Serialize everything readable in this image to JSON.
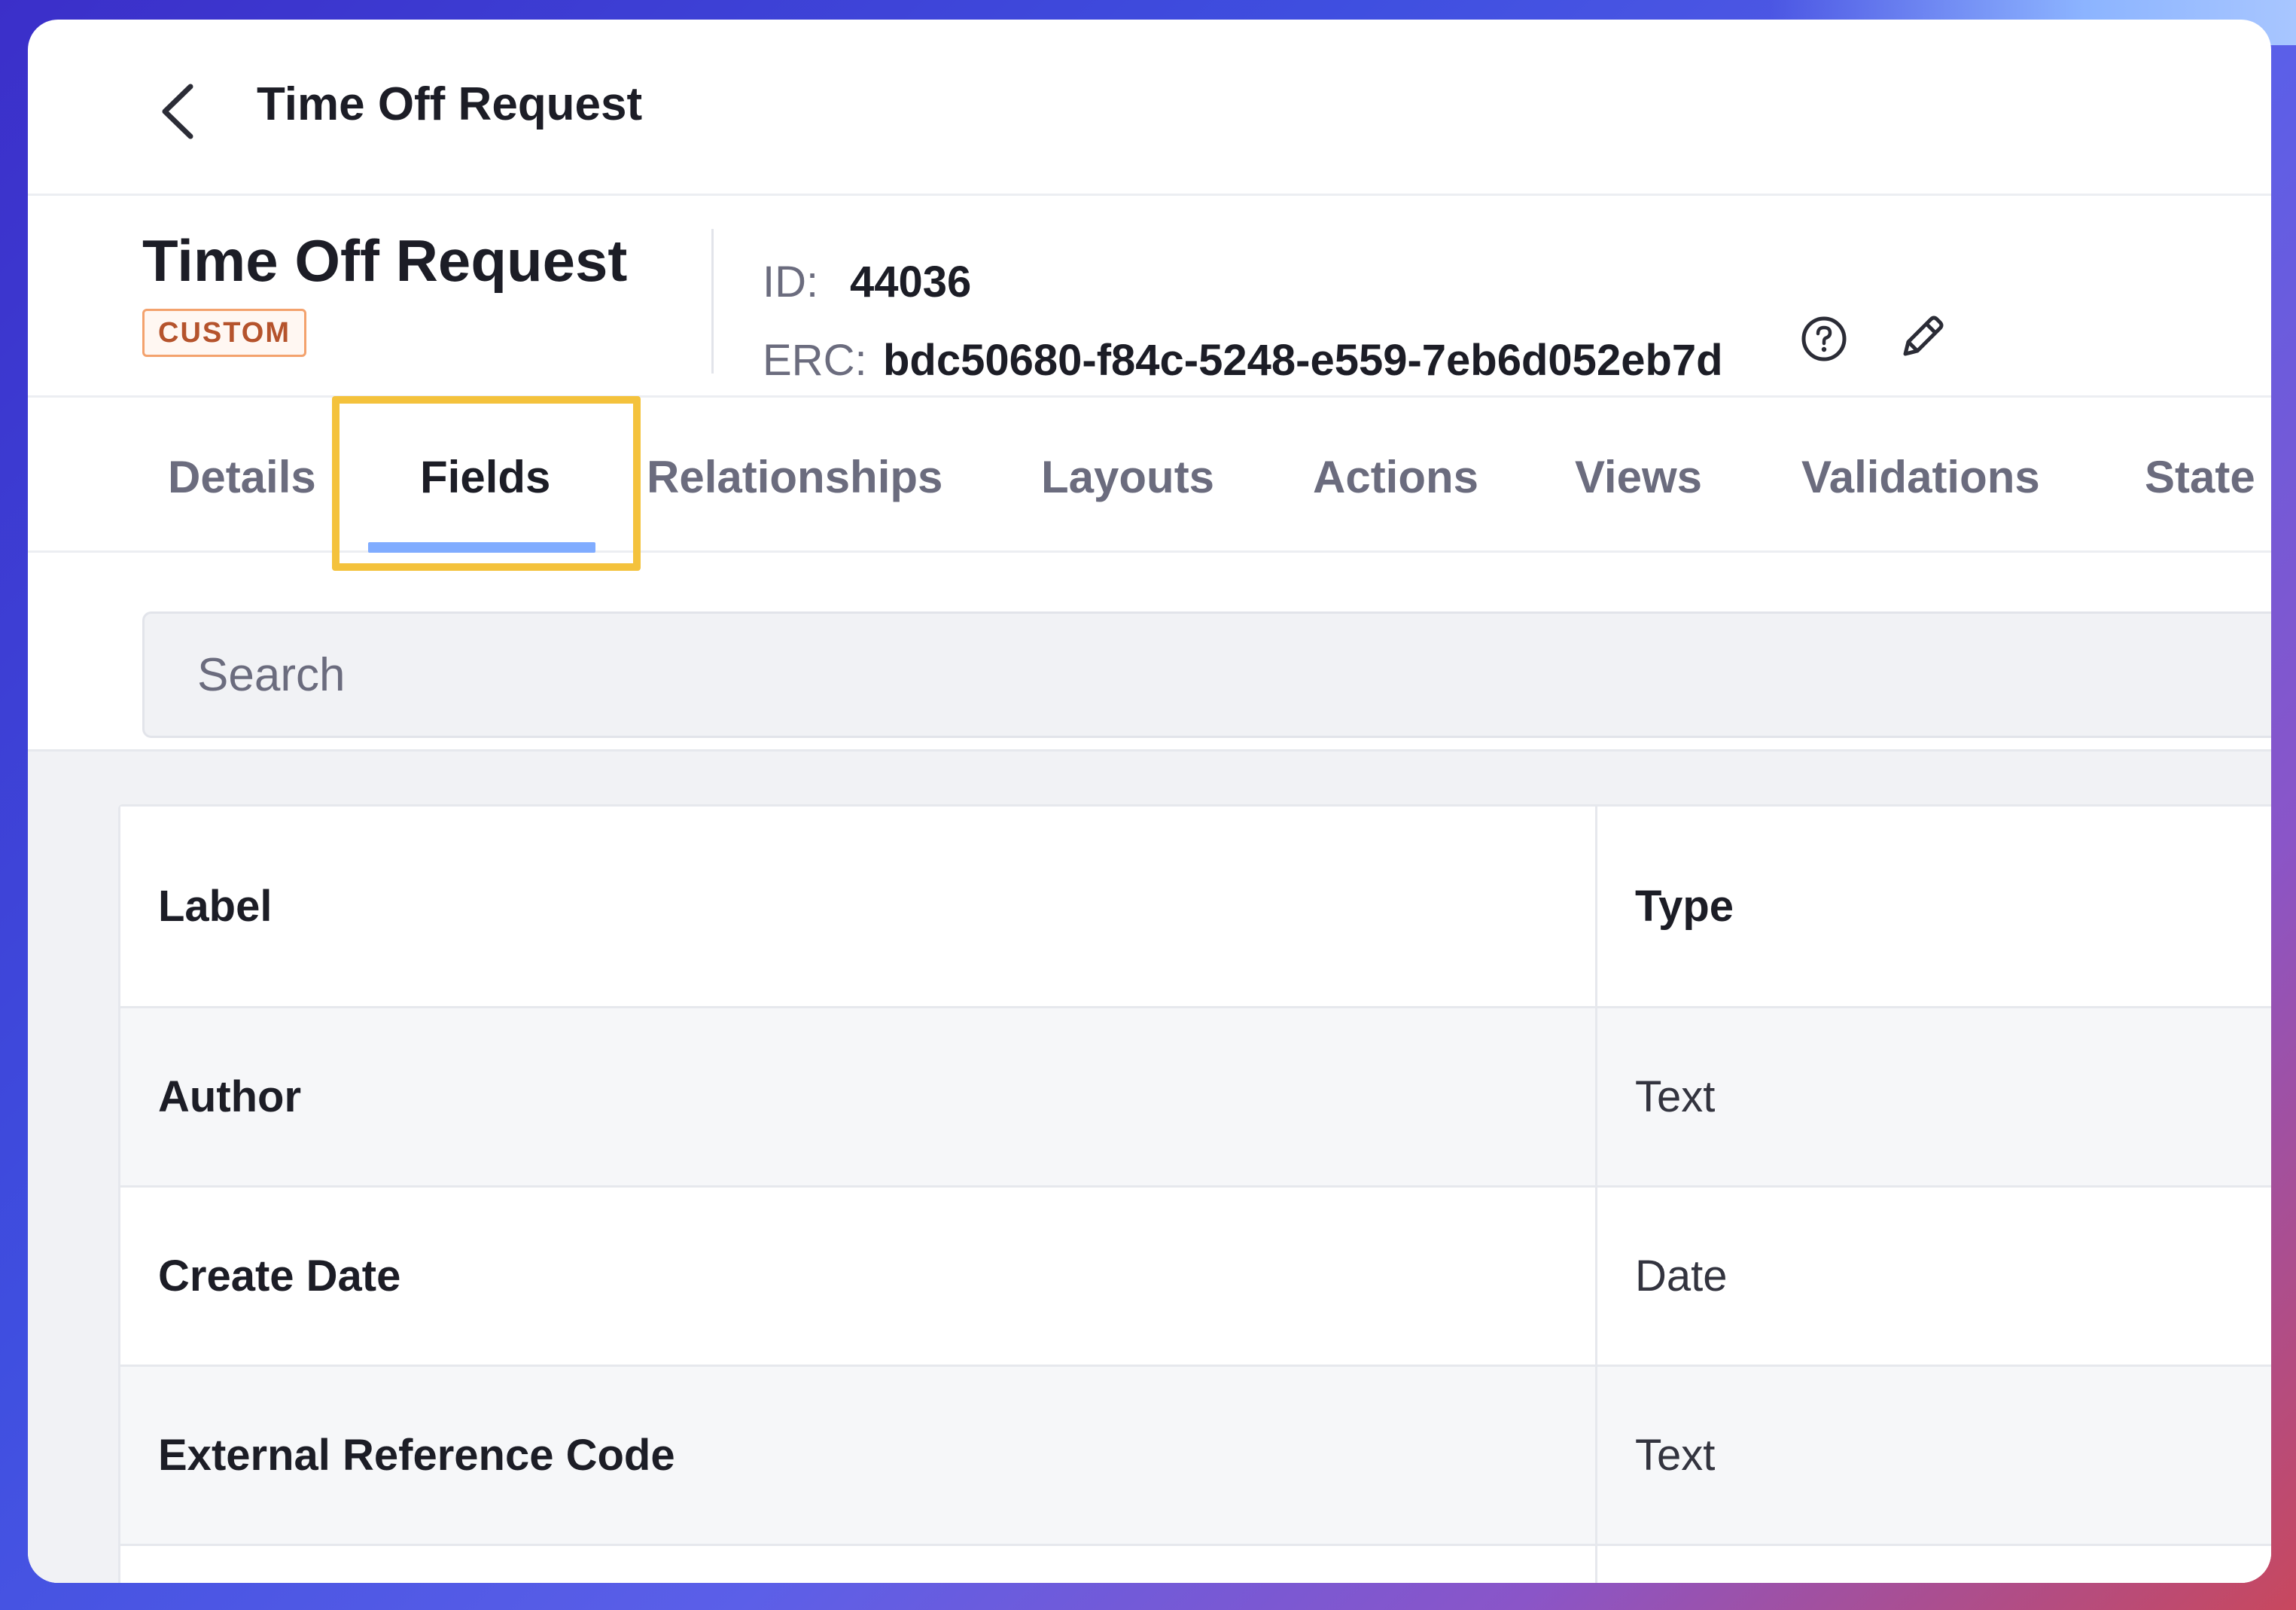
{
  "header_bar": {
    "title": "Time Off Request"
  },
  "object": {
    "title": "Time Off Request",
    "badge": "CUSTOM",
    "id_label": "ID:",
    "id_value": "44036",
    "erc_label": "ERC:",
    "erc_value": "bdc50680-f84c-5248-e559-7eb6d052eb7d"
  },
  "tabs": [
    {
      "label": "Details",
      "active": false
    },
    {
      "label": "Fields",
      "active": true
    },
    {
      "label": "Relationships",
      "active": false
    },
    {
      "label": "Layouts",
      "active": false
    },
    {
      "label": "Actions",
      "active": false
    },
    {
      "label": "Views",
      "active": false
    },
    {
      "label": "Validations",
      "active": false
    },
    {
      "label": "State",
      "active": false
    }
  ],
  "search": {
    "placeholder": "Search"
  },
  "table": {
    "columns": [
      "Label",
      "Type"
    ],
    "rows": [
      {
        "label": "Author",
        "type": "Text"
      },
      {
        "label": "Create Date",
        "type": "Date"
      },
      {
        "label": "External Reference Code",
        "type": "Text"
      }
    ]
  },
  "colors": {
    "accent": "#80acff",
    "highlight": "#f4c23c",
    "badge_border": "#f3a26d",
    "badge_text": "#b5532c"
  },
  "icons": {
    "back": "chevron-left-icon",
    "help": "question-circle-icon",
    "edit": "pencil-icon"
  }
}
